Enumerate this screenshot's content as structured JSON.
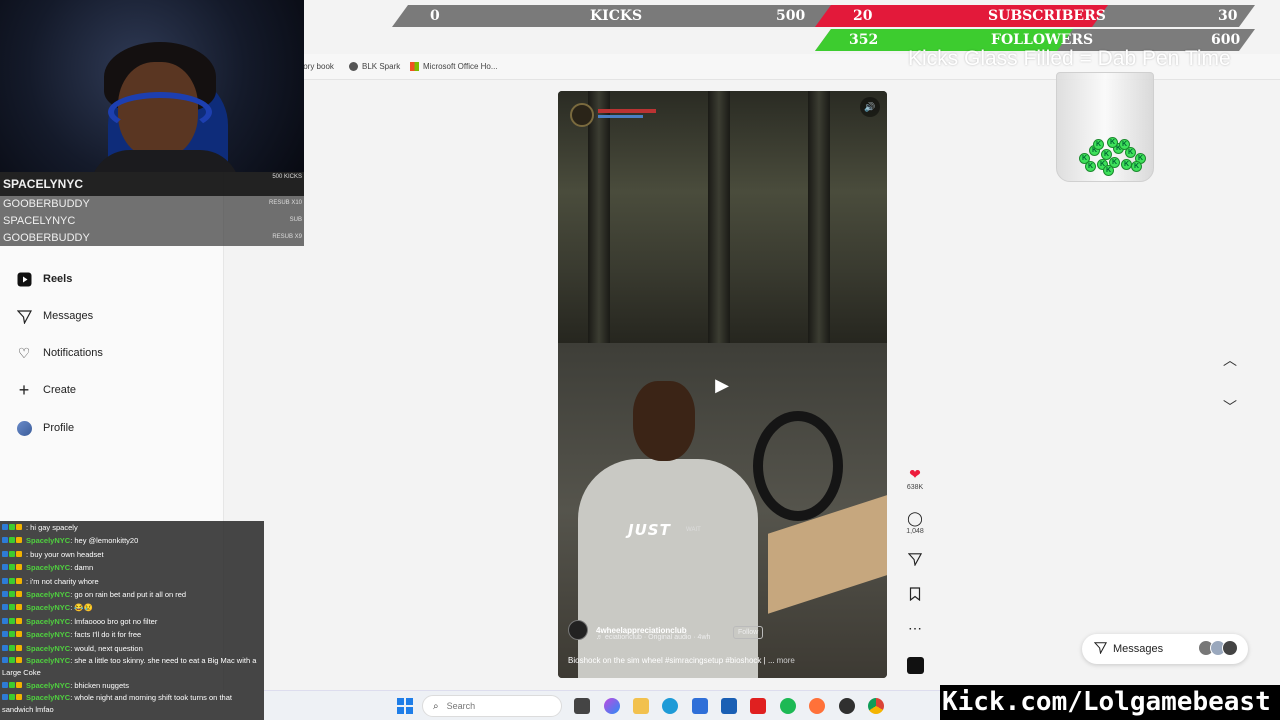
{
  "goals": {
    "kicks": {
      "label": "KICKS",
      "current": "0",
      "target": "500",
      "progress": 0.0
    },
    "subscribers": {
      "label": "SUBSCRIBERS",
      "current": "20",
      "target": "30",
      "progress": 0.667
    },
    "followers": {
      "label": "FOLLOWERS",
      "current": "352",
      "target": "600",
      "progress": 0.587
    }
  },
  "glass": {
    "caption": "Kicks Glass Filled = Dab Pen Time",
    "coin_glyph": "K"
  },
  "webcam": {
    "streamer": "SPACELYNYC",
    "alerts": [
      {
        "name": "SPACELYNYC",
        "tag": "500 KICKS"
      },
      {
        "name": "GOOBERBUDDY",
        "tag": "RESUB X10"
      },
      {
        "name": "SPACELYNYC",
        "tag": "SUB"
      },
      {
        "name": "GOOBERBUDDY",
        "tag": "RESUB X9"
      }
    ]
  },
  "bookmarks": [
    {
      "label": "tory book",
      "icon": "bookmark-icon"
    },
    {
      "label": "BLK Spark",
      "icon": "globe-icon"
    },
    {
      "label": "Microsoft Office Ho...",
      "icon": "microsoft-icon"
    }
  ],
  "sidebar": {
    "items": [
      {
        "label": "Reels",
        "icon": "reels-icon",
        "active": true
      },
      {
        "label": "Messages",
        "icon": "messages-icon"
      },
      {
        "label": "Notifications",
        "icon": "heart-icon"
      },
      {
        "label": "Create",
        "icon": "plus-icon"
      },
      {
        "label": "Profile",
        "icon": "avatar-icon"
      }
    ]
  },
  "reel": {
    "author": "4wheelappreciationclub",
    "audio": "♬ eciationclub · Original audio · 4wh",
    "follow_label": "Follow",
    "caption": "Bioshock on the sim wheel #simracingsetup #bioshock | ...",
    "more_label": "more",
    "overlay_text": "JUST",
    "overlay_small": "WAIT",
    "likes": "638K",
    "comments": "1,048"
  },
  "messages_pill": {
    "label": "Messages"
  },
  "taskbar": {
    "search_placeholder": "Search"
  },
  "chat": [
    {
      "user": "",
      "user_color": "#b06ad8",
      "msg": ": hi gay spacely"
    },
    {
      "user": "SpacelyNYC",
      "user_color": "#4fd13f",
      "msg": ": hey @lemonkitty20"
    },
    {
      "user": "",
      "user_color": "#b06ad8",
      "msg": ": buy your own headset"
    },
    {
      "user": "SpacelyNYC",
      "user_color": "#4fd13f",
      "msg": ": damn"
    },
    {
      "user": "",
      "user_color": "#b06ad8",
      "msg": ": i'm not charity whore"
    },
    {
      "user": "SpacelyNYC",
      "user_color": "#4fd13f",
      "msg": ": go on rain bet and put it all on red"
    },
    {
      "user": "SpacelyNYC",
      "user_color": "#4fd13f",
      "msg": ": 😂😢"
    },
    {
      "user": "SpacelyNYC",
      "user_color": "#4fd13f",
      "msg": ": lmfaoooo bro got no filter"
    },
    {
      "user": "SpacelyNYC",
      "user_color": "#4fd13f",
      "msg": ": facts I'll do it for free"
    },
    {
      "user": "SpacelyNYC",
      "user_color": "#4fd13f",
      "msg": ": would, next question"
    },
    {
      "user": "SpacelyNYC",
      "user_color": "#4fd13f",
      "msg": ": she a little too skinny. she need to eat a Big Mac with a Large Coke",
      "wrap": true
    },
    {
      "user": "SpacelyNYC",
      "user_color": "#4fd13f",
      "msg": ": bhicken nuggets"
    },
    {
      "user": "SpacelyNYC",
      "user_color": "#4fd13f",
      "msg": ": whole night and morning shift took turns on that sandwich lmfao",
      "wrap": true
    }
  ],
  "kick_url": "Kick.com/Lolgamebeast",
  "colors": {
    "subs_fill": "#e3193a",
    "followers_fill": "#3dcc2f",
    "heart": "#ed1c3c",
    "windows_blue": "#1f7ee8"
  }
}
